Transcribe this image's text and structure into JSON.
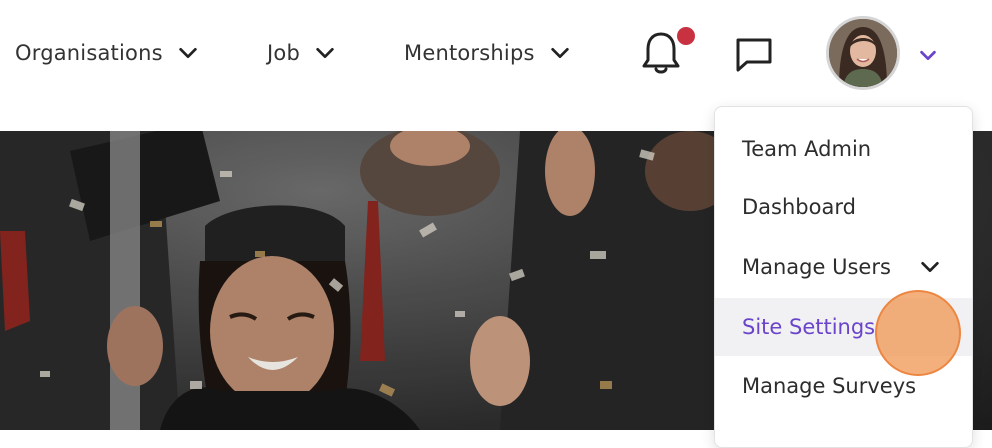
{
  "nav": {
    "items": [
      {
        "label": "Organisations"
      },
      {
        "label": "Job"
      },
      {
        "label": "Mentorships"
      }
    ]
  },
  "icons": {
    "chevron": "chevron-down-icon",
    "bell": "bell-icon",
    "chat": "message-square-icon",
    "avatar": "user-avatar"
  },
  "colors": {
    "accent": "#6a44c9",
    "notification": "#c8313f",
    "active_bg": "#f1f1f4"
  },
  "menu": {
    "items": [
      {
        "label": "Team Admin"
      },
      {
        "label": "Dashboard"
      },
      {
        "label": "Manage Users"
      },
      {
        "label": "Site Settings",
        "active": true
      },
      {
        "label": "Manage Surveys"
      }
    ]
  }
}
